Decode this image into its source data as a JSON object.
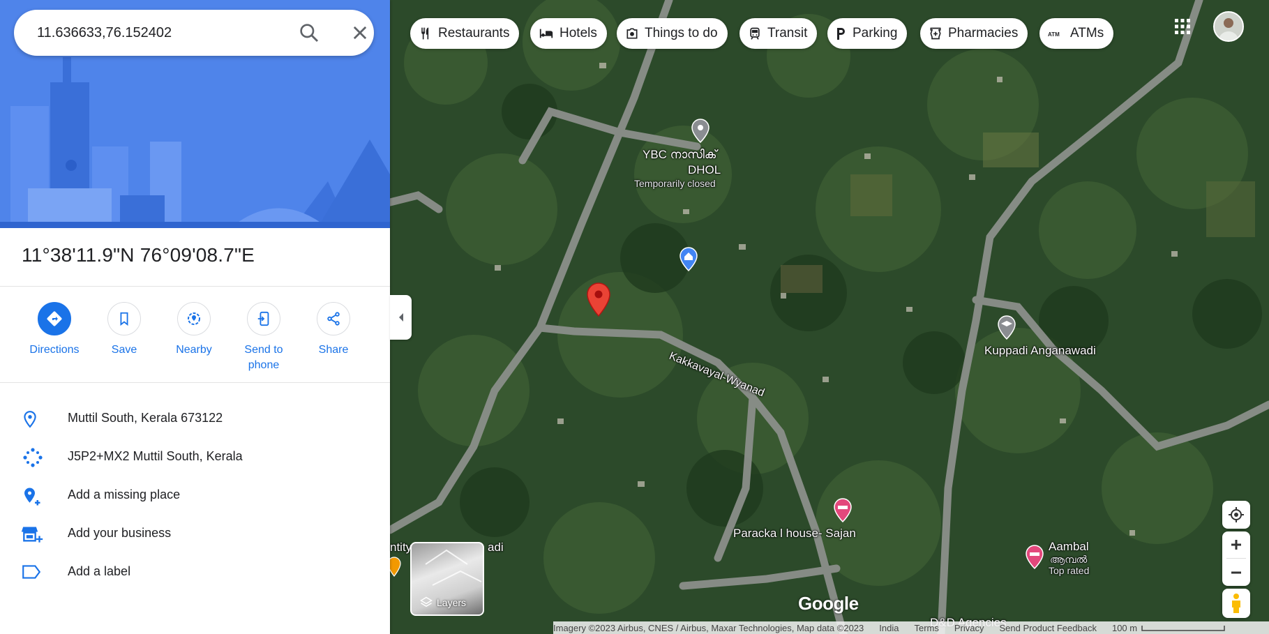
{
  "search": {
    "query": "11.636633,76.152402"
  },
  "place": {
    "coordinates_dms": "11°38'11.9\"N 76°09'08.7\"E"
  },
  "actions": [
    {
      "id": "directions",
      "label": "Directions"
    },
    {
      "id": "save",
      "label": "Save"
    },
    {
      "id": "nearby",
      "label": "Nearby"
    },
    {
      "id": "send",
      "label": "Send to phone"
    },
    {
      "id": "share",
      "label": "Share"
    }
  ],
  "info": {
    "address": "Muttil South, Kerala 673122",
    "plus_code": "J5P2+MX2 Muttil South, Kerala",
    "add_missing_place": "Add a missing place",
    "add_business": "Add your business",
    "add_label": "Add a label"
  },
  "chips": [
    {
      "id": "restaurants",
      "label": "Restaurants",
      "icon": "fork-knife-icon"
    },
    {
      "id": "hotels",
      "label": "Hotels",
      "icon": "bed-icon"
    },
    {
      "id": "things",
      "label": "Things to do",
      "icon": "camera-icon"
    },
    {
      "id": "transit",
      "label": "Transit",
      "icon": "train-icon"
    },
    {
      "id": "parking",
      "label": "Parking",
      "icon": "parking-icon"
    },
    {
      "id": "pharmacies",
      "label": "Pharmacies",
      "icon": "pharmacy-icon"
    },
    {
      "id": "atms",
      "label": "ATMs",
      "icon": "atm-icon"
    }
  ],
  "map_labels": {
    "ybc_name": "YBC നാസിക്",
    "ybc_name2": "DHOL",
    "ybc_status": "Temporarily closed",
    "road": "Kakkavayal-Wyanad",
    "anganwadi": "Kuppadi Anganawadi",
    "paracka": "Paracka l house- Sajan",
    "aambal": "Aambal",
    "aambal_ml": "ആമ്പൽ",
    "aambal_note": "Top rated",
    "dd": "D&D Agencies",
    "partial_left": "ntity",
    "partial_adi": "adi"
  },
  "layers_label": "Layers",
  "google_logo": "Google",
  "footer": {
    "imagery": "Imagery ©2023 Airbus, CNES / Airbus, Maxar Technologies, Map data ©2023",
    "country": "India",
    "terms": "Terms",
    "privacy": "Privacy",
    "feedback": "Send Product Feedback",
    "scale": "100 m"
  },
  "colors": {
    "accent": "#1a73e8",
    "pin": "#ea4335",
    "hotel_pin": "#e3487c",
    "hero_bg": "#4d82e8"
  }
}
